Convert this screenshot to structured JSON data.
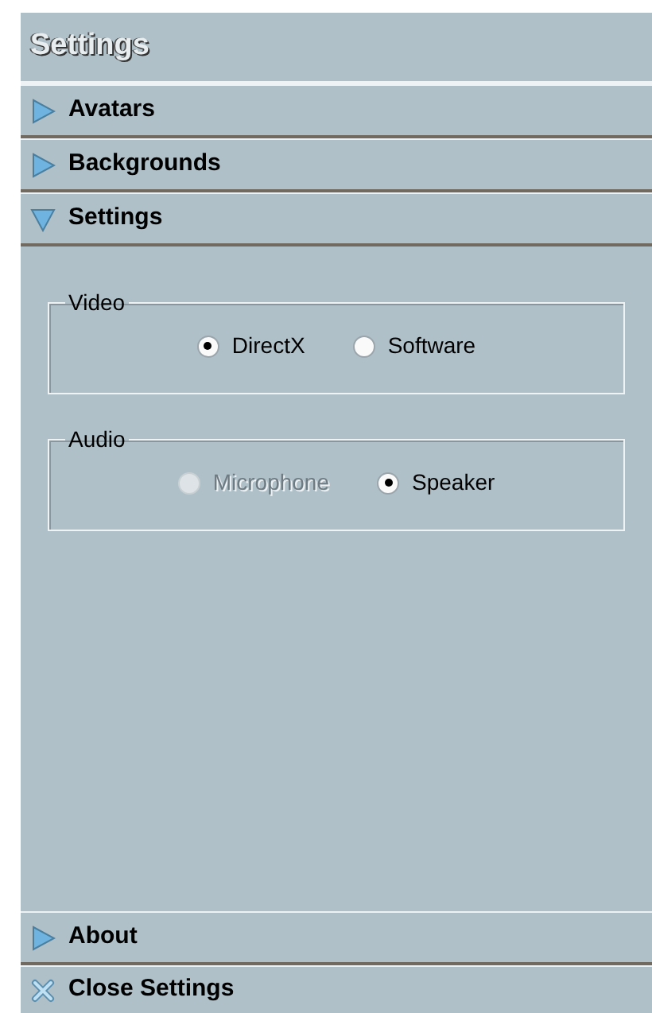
{
  "title": "Settings",
  "sections": [
    {
      "label": "Avatars",
      "expanded": false
    },
    {
      "label": "Backgrounds",
      "expanded": false
    },
    {
      "label": "Settings",
      "expanded": true,
      "groups": [
        {
          "label": "Video",
          "options": [
            {
              "label": "DirectX",
              "selected": true,
              "disabled": false
            },
            {
              "label": "Software",
              "selected": false,
              "disabled": false
            }
          ]
        },
        {
          "label": "Audio",
          "options": [
            {
              "label": "Microphone",
              "selected": false,
              "disabled": true
            },
            {
              "label": "Speaker",
              "selected": true,
              "disabled": false
            }
          ]
        }
      ]
    },
    {
      "label": "About",
      "expanded": false
    }
  ],
  "close_button": "Close Settings"
}
